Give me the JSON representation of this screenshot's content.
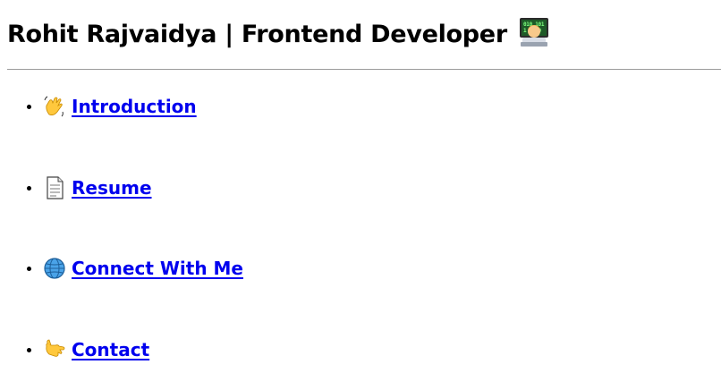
{
  "header": {
    "title": "Rohit Rajvaidya | Frontend Developer",
    "title_icon": "technologist-icon"
  },
  "nav": {
    "items": [
      {
        "label": "Introduction",
        "icon": "waving-hand-icon"
      },
      {
        "label": "Resume",
        "icon": "document-icon"
      },
      {
        "label": "Connect With Me",
        "icon": "globe-icon"
      },
      {
        "label": "Contact",
        "icon": "call-me-hand-icon"
      }
    ]
  },
  "colors": {
    "link": "#0000ee",
    "text": "#000000",
    "rule": "#9a9a9a",
    "background": "#ffffff"
  }
}
